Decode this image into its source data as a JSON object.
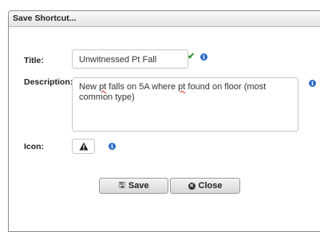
{
  "dialog": {
    "title": "Save Shortcut..."
  },
  "form": {
    "title_label": "Title:",
    "title_value": "Unwitnessed Pt Fall",
    "description_label": "Description:",
    "description_parts": [
      "New ",
      "pt",
      " falls on 5A where ",
      "pt",
      " found on floor (most common type)"
    ],
    "icon_label": "Icon:",
    "icon_value": "warning-icon"
  },
  "buttons": {
    "save_label": "Save",
    "close_label": "Close"
  },
  "colors": {
    "info": "#2d6cc8",
    "valid_check": "#2f8f2f",
    "spelling_error": "#dd2222"
  }
}
